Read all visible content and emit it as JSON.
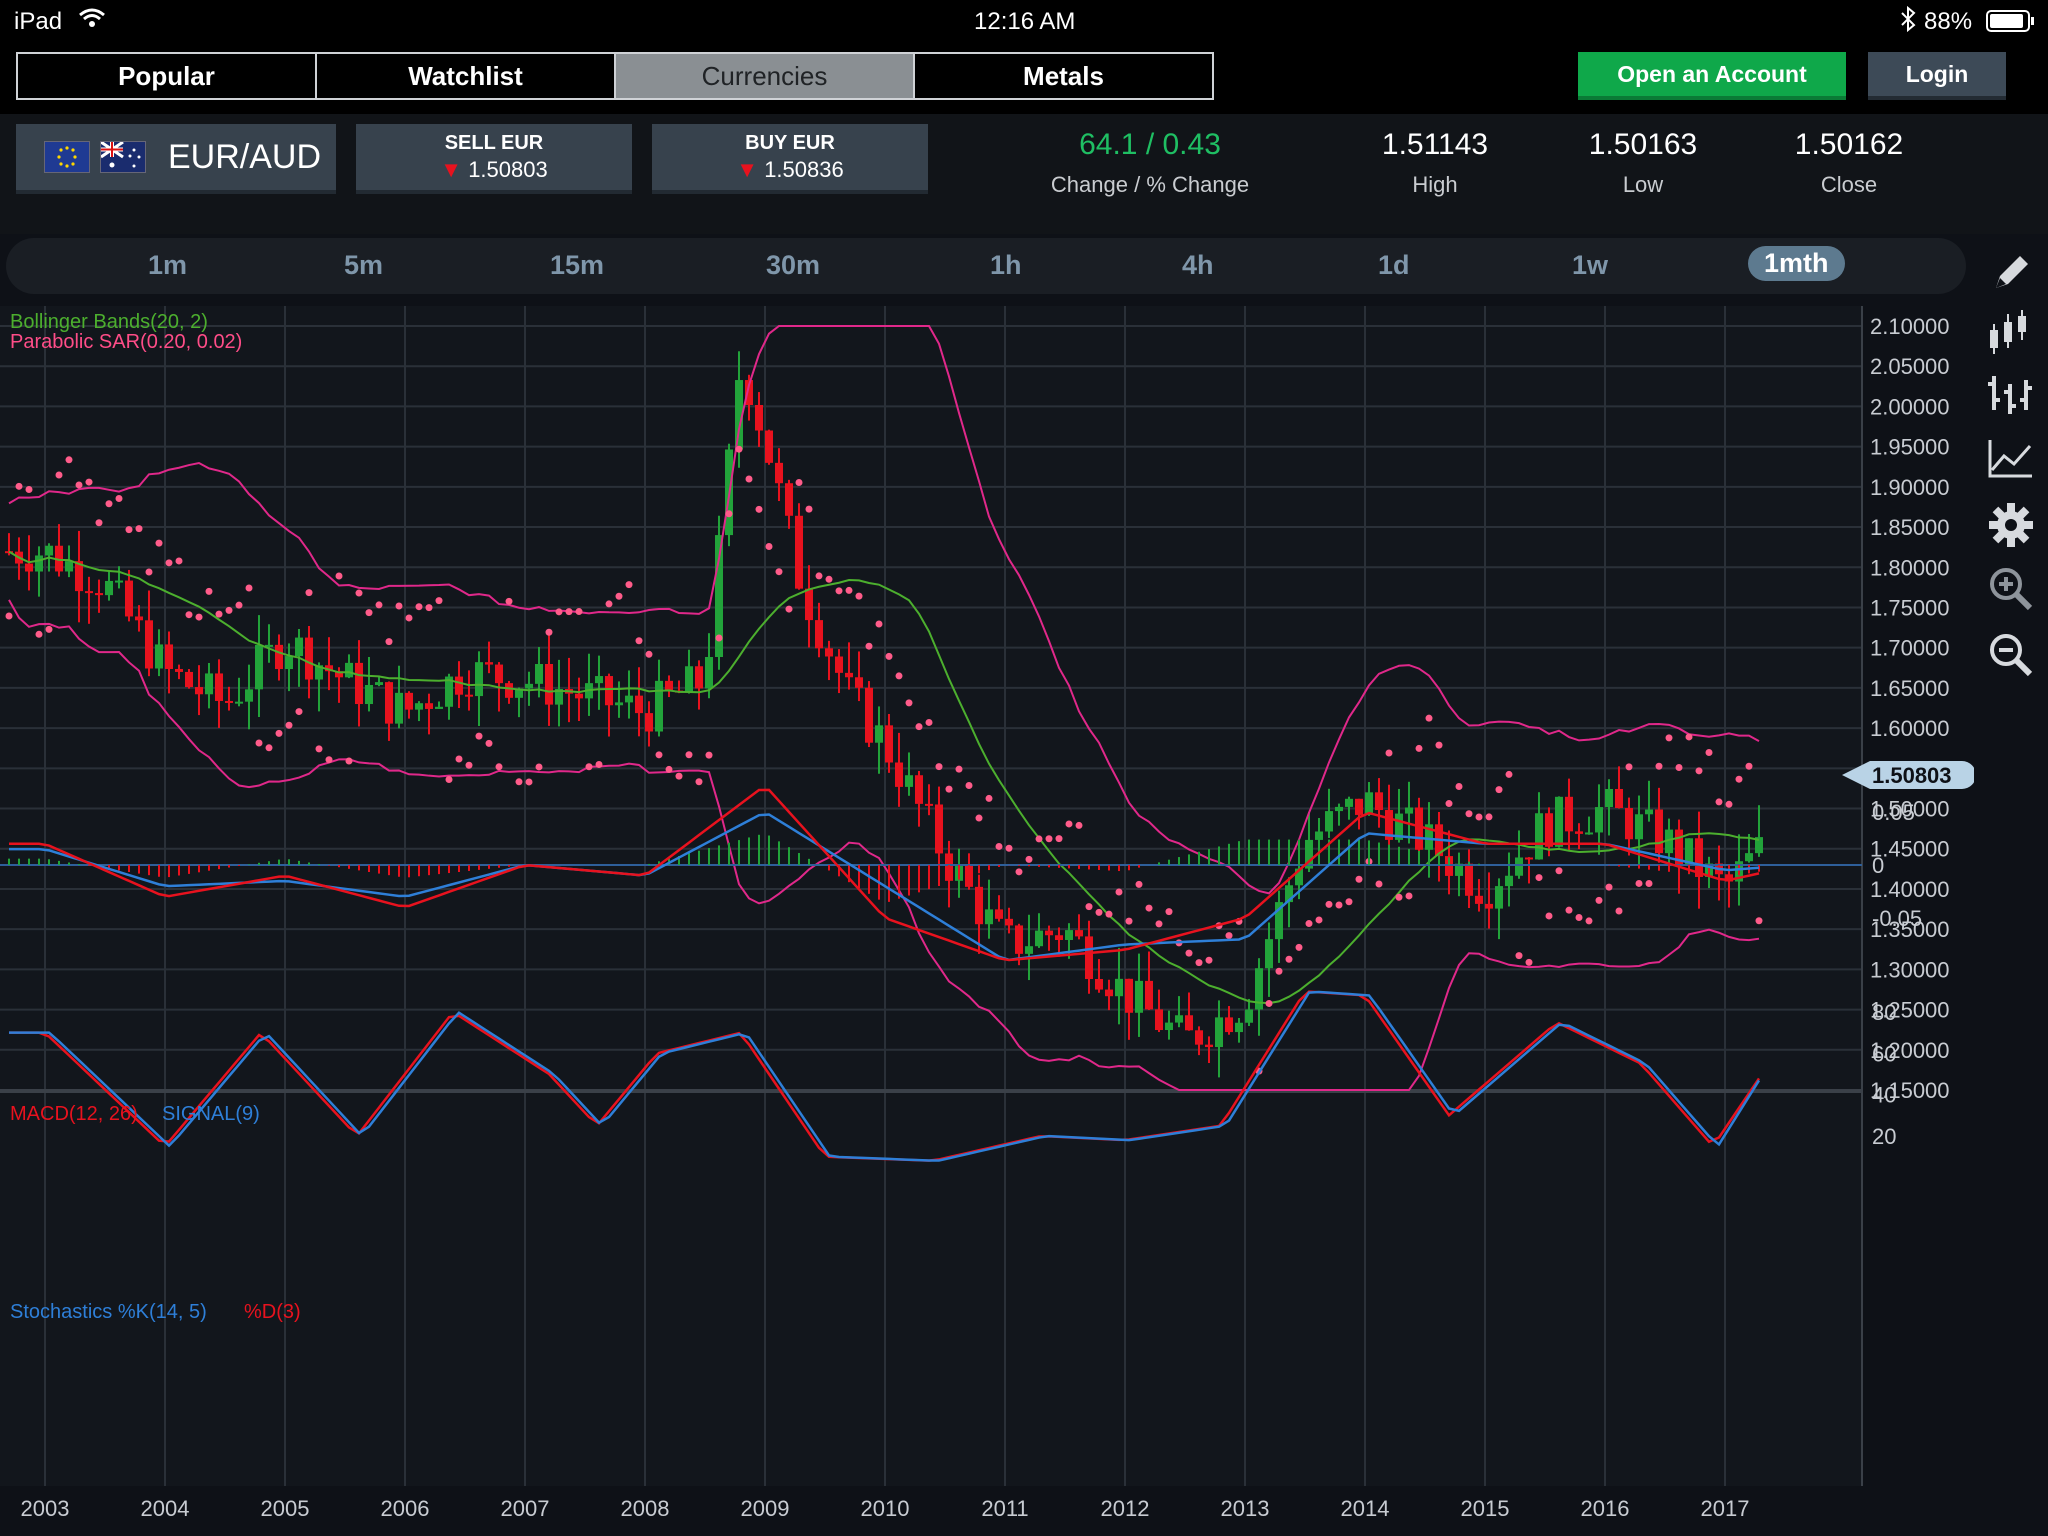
{
  "status_bar": {
    "device": "iPad",
    "time": "12:16 AM",
    "battery": "88%"
  },
  "nav": {
    "tabs": [
      "Popular",
      "Watchlist",
      "Currencies",
      "Metals"
    ],
    "active_tab": "Currencies",
    "open_account": "Open an Account",
    "login": "Login"
  },
  "quote": {
    "pair": "EUR/AUD",
    "sell": {
      "label": "SELL EUR",
      "price": "1.50803"
    },
    "buy": {
      "label": "BUY EUR",
      "price": "1.50836"
    },
    "change": "64.1 / 0.43",
    "change_label": "Change / % Change",
    "high": "1.51143",
    "high_label": "High",
    "low": "1.50163",
    "low_label": "Low",
    "close": "1.50162",
    "close_label": "Close",
    "colors": {
      "positive": "#1fbf63",
      "down_arrow": "#e8121e"
    }
  },
  "timeframes": [
    "1m",
    "5m",
    "15m",
    "30m",
    "1h",
    "4h",
    "1d",
    "1w",
    "1mth"
  ],
  "active_timeframe": "1mth",
  "toolbar": [
    "pencil-icon",
    "candlestick-icon",
    "ohlc-icon",
    "line-chart-icon",
    "gear-icon",
    "zoom-in-icon",
    "zoom-out-icon"
  ],
  "chart_data": [
    {
      "type": "candlestick",
      "labels": [
        "Bollinger Bands(20, 2)",
        "Parabolic SAR(0.20, 0.02)"
      ],
      "colors": {
        "up": "#22a33a",
        "down": "#e8121e",
        "bollinger_middle": "#4caf2e",
        "bollinger_bands": "#e0288a",
        "sar": "#ff5c8a"
      },
      "ylim": [
        1.15,
        2.1
      ],
      "y_ticks": [
        "2.10000",
        "2.05000",
        "2.00000",
        "1.95000",
        "1.90000",
        "1.85000",
        "1.80000",
        "1.75000",
        "1.70000",
        "1.65000",
        "1.60000",
        "1.55000",
        "1.50000",
        "1.45000",
        "1.40000",
        "1.35000",
        "1.30000",
        "1.25000",
        "1.20000",
        "1.15000"
      ],
      "last_price": "1.50803",
      "x_ticks": [
        "2003",
        "2004",
        "2005",
        "2006",
        "2007",
        "2008",
        "2009",
        "2010",
        "2011",
        "2012",
        "2013",
        "2014",
        "2015",
        "2016",
        "2017"
      ],
      "close_series": [
        [
          "2003",
          1.82
        ],
        [
          "2003.5",
          1.78
        ],
        [
          "2004",
          1.67
        ],
        [
          "2004.5",
          1.63
        ],
        [
          "2005",
          1.71
        ],
        [
          "2005.5",
          1.66
        ],
        [
          "2006",
          1.62
        ],
        [
          "2006.5",
          1.67
        ],
        [
          "2007",
          1.66
        ],
        [
          "2007.5",
          1.64
        ],
        [
          "2008",
          1.62
        ],
        [
          "2008.5",
          1.66
        ],
        [
          "2008.8",
          2.06
        ],
        [
          "2009",
          1.96
        ],
        [
          "2009.3",
          1.78
        ],
        [
          "2009.7",
          1.64
        ],
        [
          "2010",
          1.58
        ],
        [
          "2010.5",
          1.44
        ],
        [
          "2011",
          1.33
        ],
        [
          "2011.5",
          1.35
        ],
        [
          "2012",
          1.27
        ],
        [
          "2012.5",
          1.21
        ],
        [
          "2013",
          1.26
        ],
        [
          "2013.5",
          1.46
        ],
        [
          "2014",
          1.51
        ],
        [
          "2014.5",
          1.46
        ],
        [
          "2015",
          1.4
        ],
        [
          "2015.5",
          1.48
        ],
        [
          "2016",
          1.5
        ],
        [
          "2016.5",
          1.46
        ],
        [
          "2017",
          1.4
        ],
        [
          "2017.6",
          1.5
        ]
      ]
    },
    {
      "type": "line",
      "labels": [
        "MACD(12, 26)",
        "SIGNAL(9)"
      ],
      "colors": {
        "macd": "#e8121e",
        "signal": "#2e7fd8",
        "histogram_pos": "#22a33a",
        "histogram_neg": "#e8121e"
      },
      "y_ticks": [
        "0.05",
        "0",
        "-0.05"
      ],
      "series": [
        {
          "name": "MACD(12, 26)",
          "points": [
            [
              2003,
              0.02
            ],
            [
              2004,
              -0.03
            ],
            [
              2005,
              -0.01
            ],
            [
              2006,
              -0.04
            ],
            [
              2007,
              0.0
            ],
            [
              2008,
              -0.01
            ],
            [
              2009,
              0.075
            ],
            [
              2010,
              -0.05
            ],
            [
              2011,
              -0.09
            ],
            [
              2012,
              -0.08
            ],
            [
              2013,
              -0.05
            ],
            [
              2014,
              0.05
            ],
            [
              2015,
              0.02
            ],
            [
              2016,
              0.02
            ],
            [
              2017,
              -0.015
            ],
            [
              2017.6,
              0.0
            ]
          ]
        },
        {
          "name": "SIGNAL(9)",
          "points": [
            [
              2003,
              0.015
            ],
            [
              2004,
              -0.02
            ],
            [
              2005,
              -0.015
            ],
            [
              2006,
              -0.03
            ],
            [
              2007,
              0.0
            ],
            [
              2008,
              -0.01
            ],
            [
              2009,
              0.05
            ],
            [
              2010,
              -0.02
            ],
            [
              2011,
              -0.09
            ],
            [
              2012,
              -0.075
            ],
            [
              2013,
              -0.07
            ],
            [
              2014,
              0.03
            ],
            [
              2015,
              0.02
            ],
            [
              2016,
              0.02
            ],
            [
              2017,
              -0.005
            ],
            [
              2017.6,
              0.0
            ]
          ]
        }
      ]
    },
    {
      "type": "line",
      "labels": [
        "Stochastics %K(14, 5)",
        "%D(3)"
      ],
      "colors": {
        "k": "#2e7fd8",
        "d": "#e8121e"
      },
      "y_ticks": [
        "80",
        "60",
        "40",
        "20"
      ],
      "series": [
        {
          "name": "Stochastics %K(14, 5)",
          "points": [
            [
              2003,
              70
            ],
            [
              2004,
              15
            ],
            [
              2004.8,
              70
            ],
            [
              2005.6,
              20
            ],
            [
              2006.4,
              80
            ],
            [
              2007.2,
              50
            ],
            [
              2007.6,
              25
            ],
            [
              2008.1,
              60
            ],
            [
              2008.8,
              70
            ],
            [
              2009.5,
              10
            ],
            [
              2010.4,
              8
            ],
            [
              2011.3,
              20
            ],
            [
              2012,
              18
            ],
            [
              2012.8,
              25
            ],
            [
              2013.5,
              90
            ],
            [
              2014,
              88
            ],
            [
              2014.7,
              30
            ],
            [
              2015.6,
              75
            ],
            [
              2016.3,
              55
            ],
            [
              2016.9,
              15
            ],
            [
              2017.6,
              80
            ]
          ]
        },
        {
          "name": "%D(3)",
          "points": [
            [
              2003,
              70
            ],
            [
              2004,
              15
            ],
            [
              2004.8,
              70
            ],
            [
              2005.6,
              20
            ],
            [
              2006.4,
              80
            ],
            [
              2007.2,
              50
            ],
            [
              2007.6,
              25
            ],
            [
              2008.1,
              60
            ],
            [
              2008.8,
              70
            ],
            [
              2009.5,
              10
            ],
            [
              2010.4,
              8
            ],
            [
              2011.3,
              20
            ],
            [
              2012,
              18
            ],
            [
              2012.8,
              25
            ],
            [
              2013.5,
              90
            ],
            [
              2014,
              88
            ],
            [
              2014.7,
              30
            ],
            [
              2015.6,
              75
            ],
            [
              2016.3,
              55
            ],
            [
              2016.9,
              15
            ],
            [
              2017.6,
              75
            ]
          ]
        }
      ]
    }
  ]
}
